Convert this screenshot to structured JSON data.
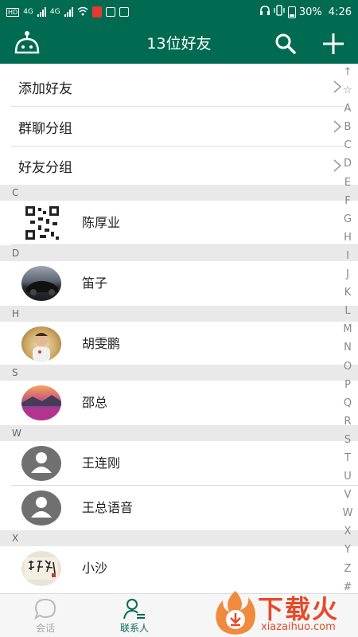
{
  "status_bar": {
    "left_badges": [
      "HD",
      "4G",
      "4G",
      "HD"
    ],
    "battery": "30%",
    "time": "4:26"
  },
  "header": {
    "title": "13位好友"
  },
  "menu": [
    {
      "label": "添加好友"
    },
    {
      "label": "群聊分组"
    },
    {
      "label": "好友分组"
    }
  ],
  "sections": [
    {
      "letter": "C",
      "contacts": [
        {
          "name": "陈厚业",
          "avatar": "qr-code-avatar"
        }
      ]
    },
    {
      "letter": "D",
      "contacts": [
        {
          "name": "笛子",
          "avatar": "car-photo-avatar"
        }
      ]
    },
    {
      "letter": "H",
      "contacts": [
        {
          "name": "胡雯鹏",
          "avatar": "child-photo-avatar"
        }
      ]
    },
    {
      "letter": "S",
      "contacts": [
        {
          "name": "邵总",
          "avatar": "landscape-photo-avatar"
        }
      ]
    },
    {
      "letter": "W",
      "contacts": [
        {
          "name": "王连刚",
          "avatar": "default-avatar"
        },
        {
          "name": "王总语音",
          "avatar": "default-avatar"
        }
      ]
    },
    {
      "letter": "X",
      "contacts": [
        {
          "name": "小沙",
          "avatar": "calligraphy-avatar"
        }
      ]
    }
  ],
  "index_letters": [
    "↑",
    "☆",
    "A",
    "B",
    "C",
    "D",
    "E",
    "F",
    "G",
    "H",
    "I",
    "J",
    "K",
    "L",
    "M",
    "N",
    "O",
    "P",
    "Q",
    "R",
    "S",
    "T",
    "U",
    "V",
    "W",
    "X",
    "Y",
    "Z",
    "#"
  ],
  "tabs": [
    {
      "label": "会话",
      "icon": "chat-bubble-icon",
      "active": false
    },
    {
      "label": "联系人",
      "icon": "contacts-icon",
      "active": true
    }
  ],
  "watermark": {
    "title": "下载火",
    "url": "xiazaihuo.com"
  },
  "colors": {
    "primary": "#006b50",
    "section_bg": "#e9e9e9",
    "watermark": "#e8492a"
  }
}
